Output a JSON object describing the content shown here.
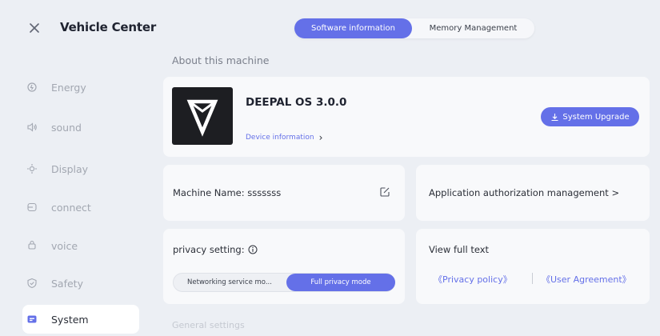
{
  "header": {
    "title": "Vehicle Center",
    "tabs": [
      {
        "label": "Software information",
        "active": true
      },
      {
        "label": "Memory Management",
        "active": false
      }
    ]
  },
  "sidebar": {
    "items": [
      {
        "label": "Energy",
        "icon": "energy-icon",
        "active": false
      },
      {
        "label": "sound",
        "icon": "speaker-icon",
        "active": false
      },
      {
        "label": "Display",
        "icon": "brightness-icon",
        "active": false
      },
      {
        "label": "connect",
        "icon": "connect-icon",
        "active": false
      },
      {
        "label": "voice",
        "icon": "voice-icon",
        "active": false
      },
      {
        "label": "Safety",
        "icon": "shield-icon",
        "active": false
      },
      {
        "label": "System",
        "icon": "system-icon",
        "active": true
      }
    ]
  },
  "about": {
    "heading": "About this machine",
    "os_name": "DEEPAL OS 3.0.0",
    "device_info_label": "Device information",
    "upgrade_label": "System Upgrade"
  },
  "machine": {
    "name_label": "Machine Name: sssssss"
  },
  "authorization": {
    "label": "Application authorization management >"
  },
  "privacy": {
    "title": "privacy setting:",
    "modes": [
      "Networking service mo...",
      "Full privacy mode"
    ],
    "selected_mode": "Full privacy mode"
  },
  "full_text": {
    "title": "View full text",
    "privacy_policy": "《Privacy policy》",
    "user_agreement": "《User Agreement》"
  },
  "general": {
    "heading": "General settings"
  },
  "colors": {
    "accent": "#6470e8",
    "background": "#eceff4",
    "card": "#f8f9fb"
  }
}
